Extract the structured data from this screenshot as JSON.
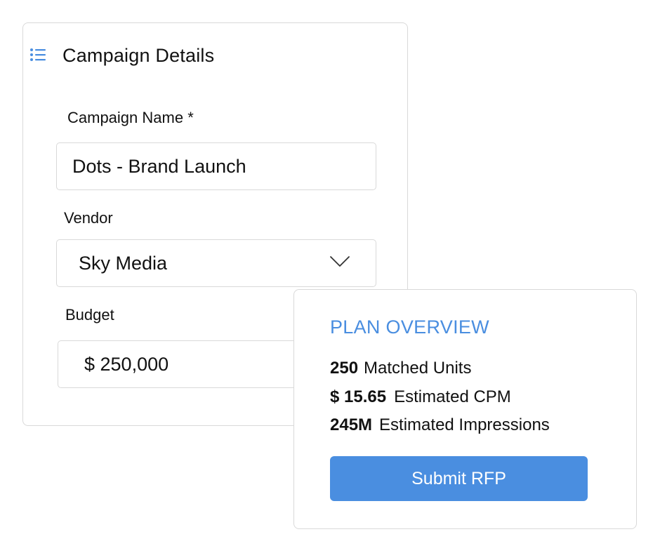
{
  "campaign": {
    "title": "Campaign Details",
    "name_label": "Campaign Name *",
    "name_value": "Dots - Brand Launch",
    "vendor_label": "Vendor",
    "vendor_value": "Sky Media",
    "budget_label": "Budget",
    "budget_value": "$ 250,000"
  },
  "plan": {
    "title": "PLAN OVERVIEW",
    "stats": [
      {
        "value": "250",
        "label": "Matched Units"
      },
      {
        "value": "$ 15.65",
        "label": "Estimated CPM"
      },
      {
        "value": "245M",
        "label": "Estimated Impressions"
      }
    ],
    "submit_label": "Submit RFP"
  },
  "colors": {
    "accent": "#4a8ee0",
    "border": "#d9d9d9",
    "text": "#111111"
  },
  "icons": {
    "header": "list-icon",
    "vendor_dropdown": "chevron-down-icon"
  }
}
